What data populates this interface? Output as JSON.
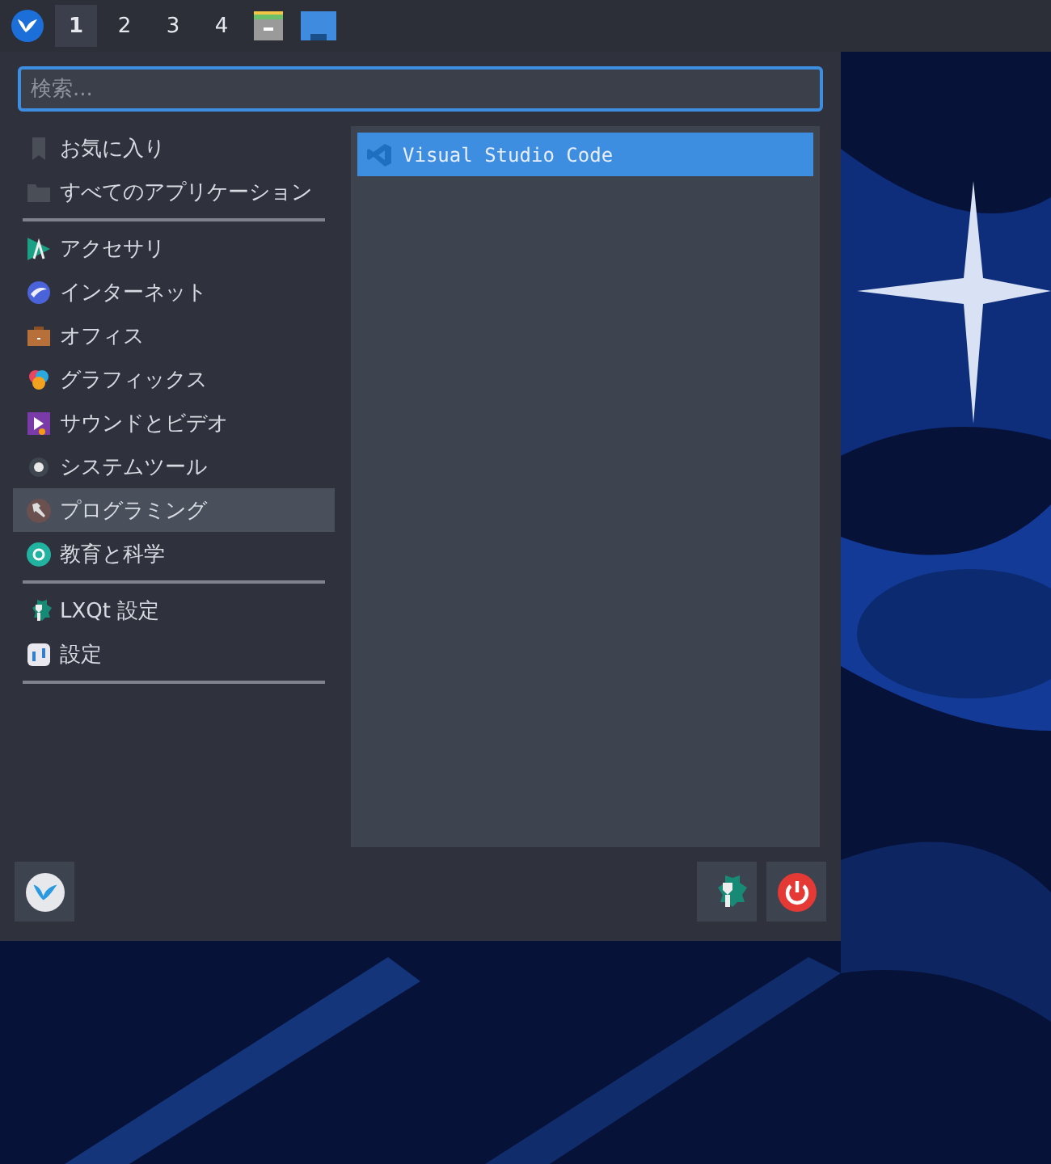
{
  "panel": {
    "desktops": [
      {
        "label": "1",
        "selected": true
      },
      {
        "label": "2",
        "selected": false
      },
      {
        "label": "3",
        "selected": false
      },
      {
        "label": "4",
        "selected": false
      }
    ]
  },
  "menu": {
    "search": {
      "placeholder": "検索..."
    },
    "categories": [
      {
        "kind": "item",
        "label": "お気に入り",
        "selected": false
      },
      {
        "kind": "item",
        "label": "すべてのアプリケーション",
        "selected": false
      },
      {
        "kind": "separator"
      },
      {
        "kind": "item",
        "label": "アクセサリ",
        "selected": false
      },
      {
        "kind": "item",
        "label": "インターネット",
        "selected": false
      },
      {
        "kind": "item",
        "label": "オフィス",
        "selected": false
      },
      {
        "kind": "item",
        "label": "グラフィックス",
        "selected": false
      },
      {
        "kind": "item",
        "label": "サウンドとビデオ",
        "selected": false
      },
      {
        "kind": "item",
        "label": "システムツール",
        "selected": false
      },
      {
        "kind": "item",
        "label": "プログラミング",
        "selected": true
      },
      {
        "kind": "item",
        "label": "教育と科学",
        "selected": false
      },
      {
        "kind": "separator"
      },
      {
        "kind": "item",
        "label": "LXQt 設定",
        "selected": false
      },
      {
        "kind": "item",
        "label": "設定",
        "selected": false
      },
      {
        "kind": "separator"
      }
    ],
    "apps": [
      {
        "label": "Visual Studio Code",
        "selected": true
      }
    ]
  }
}
